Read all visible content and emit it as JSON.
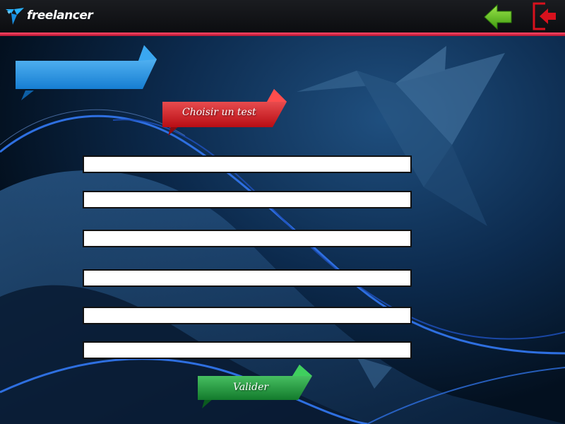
{
  "app": {
    "brand": "freelancer"
  },
  "header": {
    "back_icon": "arrow-left-icon",
    "exit_icon": "exit-door-icon",
    "back_color": "#5cc21e",
    "exit_color": "#d8111d"
  },
  "title_ribbon": {
    "label": "",
    "color": "#1a8fe0"
  },
  "test_ribbon": {
    "label": "Choisir un test",
    "color": "#d4141b"
  },
  "form": {
    "fields": [
      {
        "value": "",
        "placeholder": ""
      },
      {
        "value": "",
        "placeholder": ""
      },
      {
        "value": "",
        "placeholder": ""
      },
      {
        "value": "",
        "placeholder": ""
      },
      {
        "value": "",
        "placeholder": ""
      },
      {
        "value": "",
        "placeholder": ""
      }
    ],
    "submit_label": "Valider",
    "submit_color": "#1e9e3a"
  }
}
